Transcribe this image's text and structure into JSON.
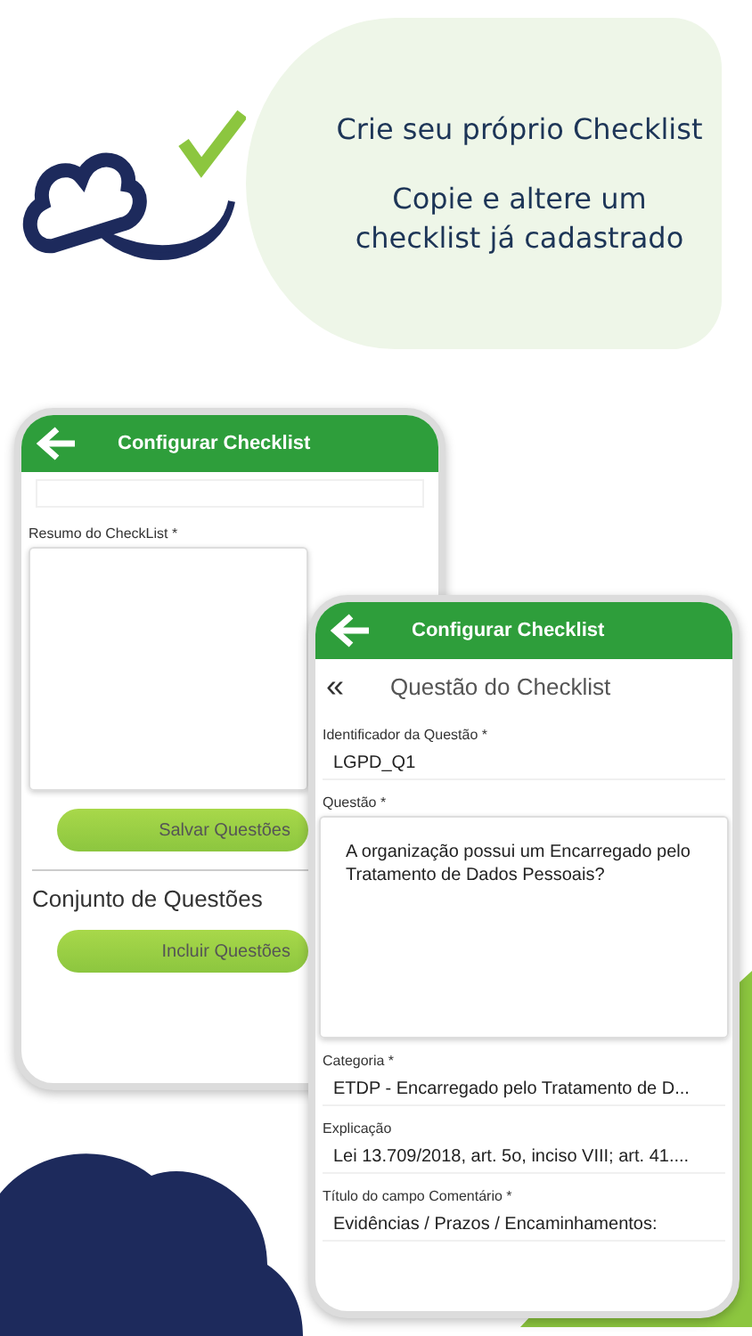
{
  "promo": {
    "line_1": "Crie seu próprio Checklist",
    "line_2": "Copie e altere um checklist já cadastrado"
  },
  "back_screen": {
    "title": "Configurar Checklist",
    "summary_label": "Resumo do CheckList *",
    "save_button": "Salvar Questões",
    "section_title": "Conjunto de Questões",
    "add_button": "Incluir Questões"
  },
  "front_screen": {
    "title": "Configurar Checklist",
    "back_glyph": "«",
    "subtitle": "Questão do Checklist",
    "fields": [
      {
        "kind": "line",
        "label": "Identificador da Questão *",
        "value": "LGPD_Q1"
      },
      {
        "kind": "area",
        "label": "Questão *",
        "value": "A organização possui um Encarregado pelo Tratamento de Dados Pessoais?"
      },
      {
        "kind": "line",
        "label": "Categoria *",
        "value": "ETDP - Encarregado pelo Tratamento de D..."
      },
      {
        "kind": "line",
        "label": "Explicação",
        "value": "Lei 13.709/2018, art. 5o, inciso VIII; art. 41...."
      },
      {
        "kind": "line",
        "label": "Título do campo Comentário *",
        "value": "Evidências / Prazos / Encaminhamentos:"
      }
    ]
  }
}
